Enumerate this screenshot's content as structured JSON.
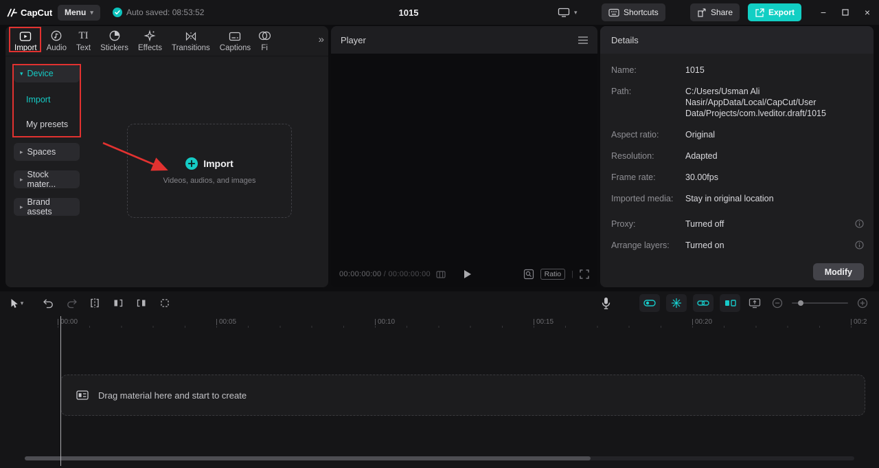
{
  "colors": {
    "accent": "#15cbc5",
    "export_bg": "#12cfc4",
    "annotation_red": "#e23230",
    "panel_bg": "#1e1e20",
    "window_bg": "#0d0d0f"
  },
  "titlebar": {
    "app_name": "CapCut",
    "menu": "Menu",
    "autosave": "Auto saved: 08:53:52",
    "project_title": "1015",
    "shortcuts": "Shortcuts",
    "share": "Share",
    "export": "Export"
  },
  "media_panel": {
    "tabs": [
      {
        "label": "Import",
        "icon": "import-icon",
        "active": true
      },
      {
        "label": "Audio",
        "icon": "audio-icon"
      },
      {
        "label": "Text",
        "icon": "text-icon",
        "icon_text": "TI"
      },
      {
        "label": "Stickers",
        "icon": "stickers-icon"
      },
      {
        "label": "Effects",
        "icon": "effects-icon"
      },
      {
        "label": "Transitions",
        "icon": "transitions-icon"
      },
      {
        "label": "Captions",
        "icon": "captions-icon"
      },
      {
        "label": "Fi",
        "icon": "filters-icon"
      }
    ],
    "sidebar": {
      "device": "Device",
      "device_children": [
        "Import",
        "My presets"
      ],
      "selected_child": "Import",
      "collapsed": [
        "Spaces",
        "Stock mater...",
        "Brand assets"
      ]
    },
    "dropzone": {
      "button": "Import",
      "hint": "Videos, audios, and images"
    }
  },
  "player": {
    "title": "Player",
    "current": "00:00:00:00",
    "separator": "/",
    "total": "00:00:00:00",
    "ratio": "Ratio"
  },
  "details": {
    "title": "Details",
    "rows": [
      {
        "label": "Name:",
        "value": "1015"
      },
      {
        "label": "Path:",
        "value": "C:/Users/Usman Ali Nasir/AppData/Local/CapCut/User Data/Projects/com.lveditor.draft/1015"
      },
      {
        "label": "Aspect ratio:",
        "value": "Original"
      },
      {
        "label": "Resolution:",
        "value": "Adapted"
      },
      {
        "label": "Frame rate:",
        "value": "30.00fps"
      },
      {
        "label": "Imported media:",
        "value": "Stay in original location"
      },
      {
        "label": "Proxy:",
        "value": "Turned off",
        "info": true
      },
      {
        "label": "Arrange layers:",
        "value": "Turned on",
        "info": true
      }
    ],
    "modify": "Modify"
  },
  "timeline": {
    "ruler": [
      "00:00",
      "00:05",
      "00:10",
      "00:15",
      "00:20",
      "00:2"
    ],
    "placeholder": "Drag material here and start to create"
  },
  "icons": {
    "menu_caret": "▾",
    "display_caret": "▾",
    "caret_down": "▾",
    "caret_right": "▸",
    "tabs_expand": "»",
    "minimize": "−",
    "close": "×",
    "divider": "|"
  }
}
